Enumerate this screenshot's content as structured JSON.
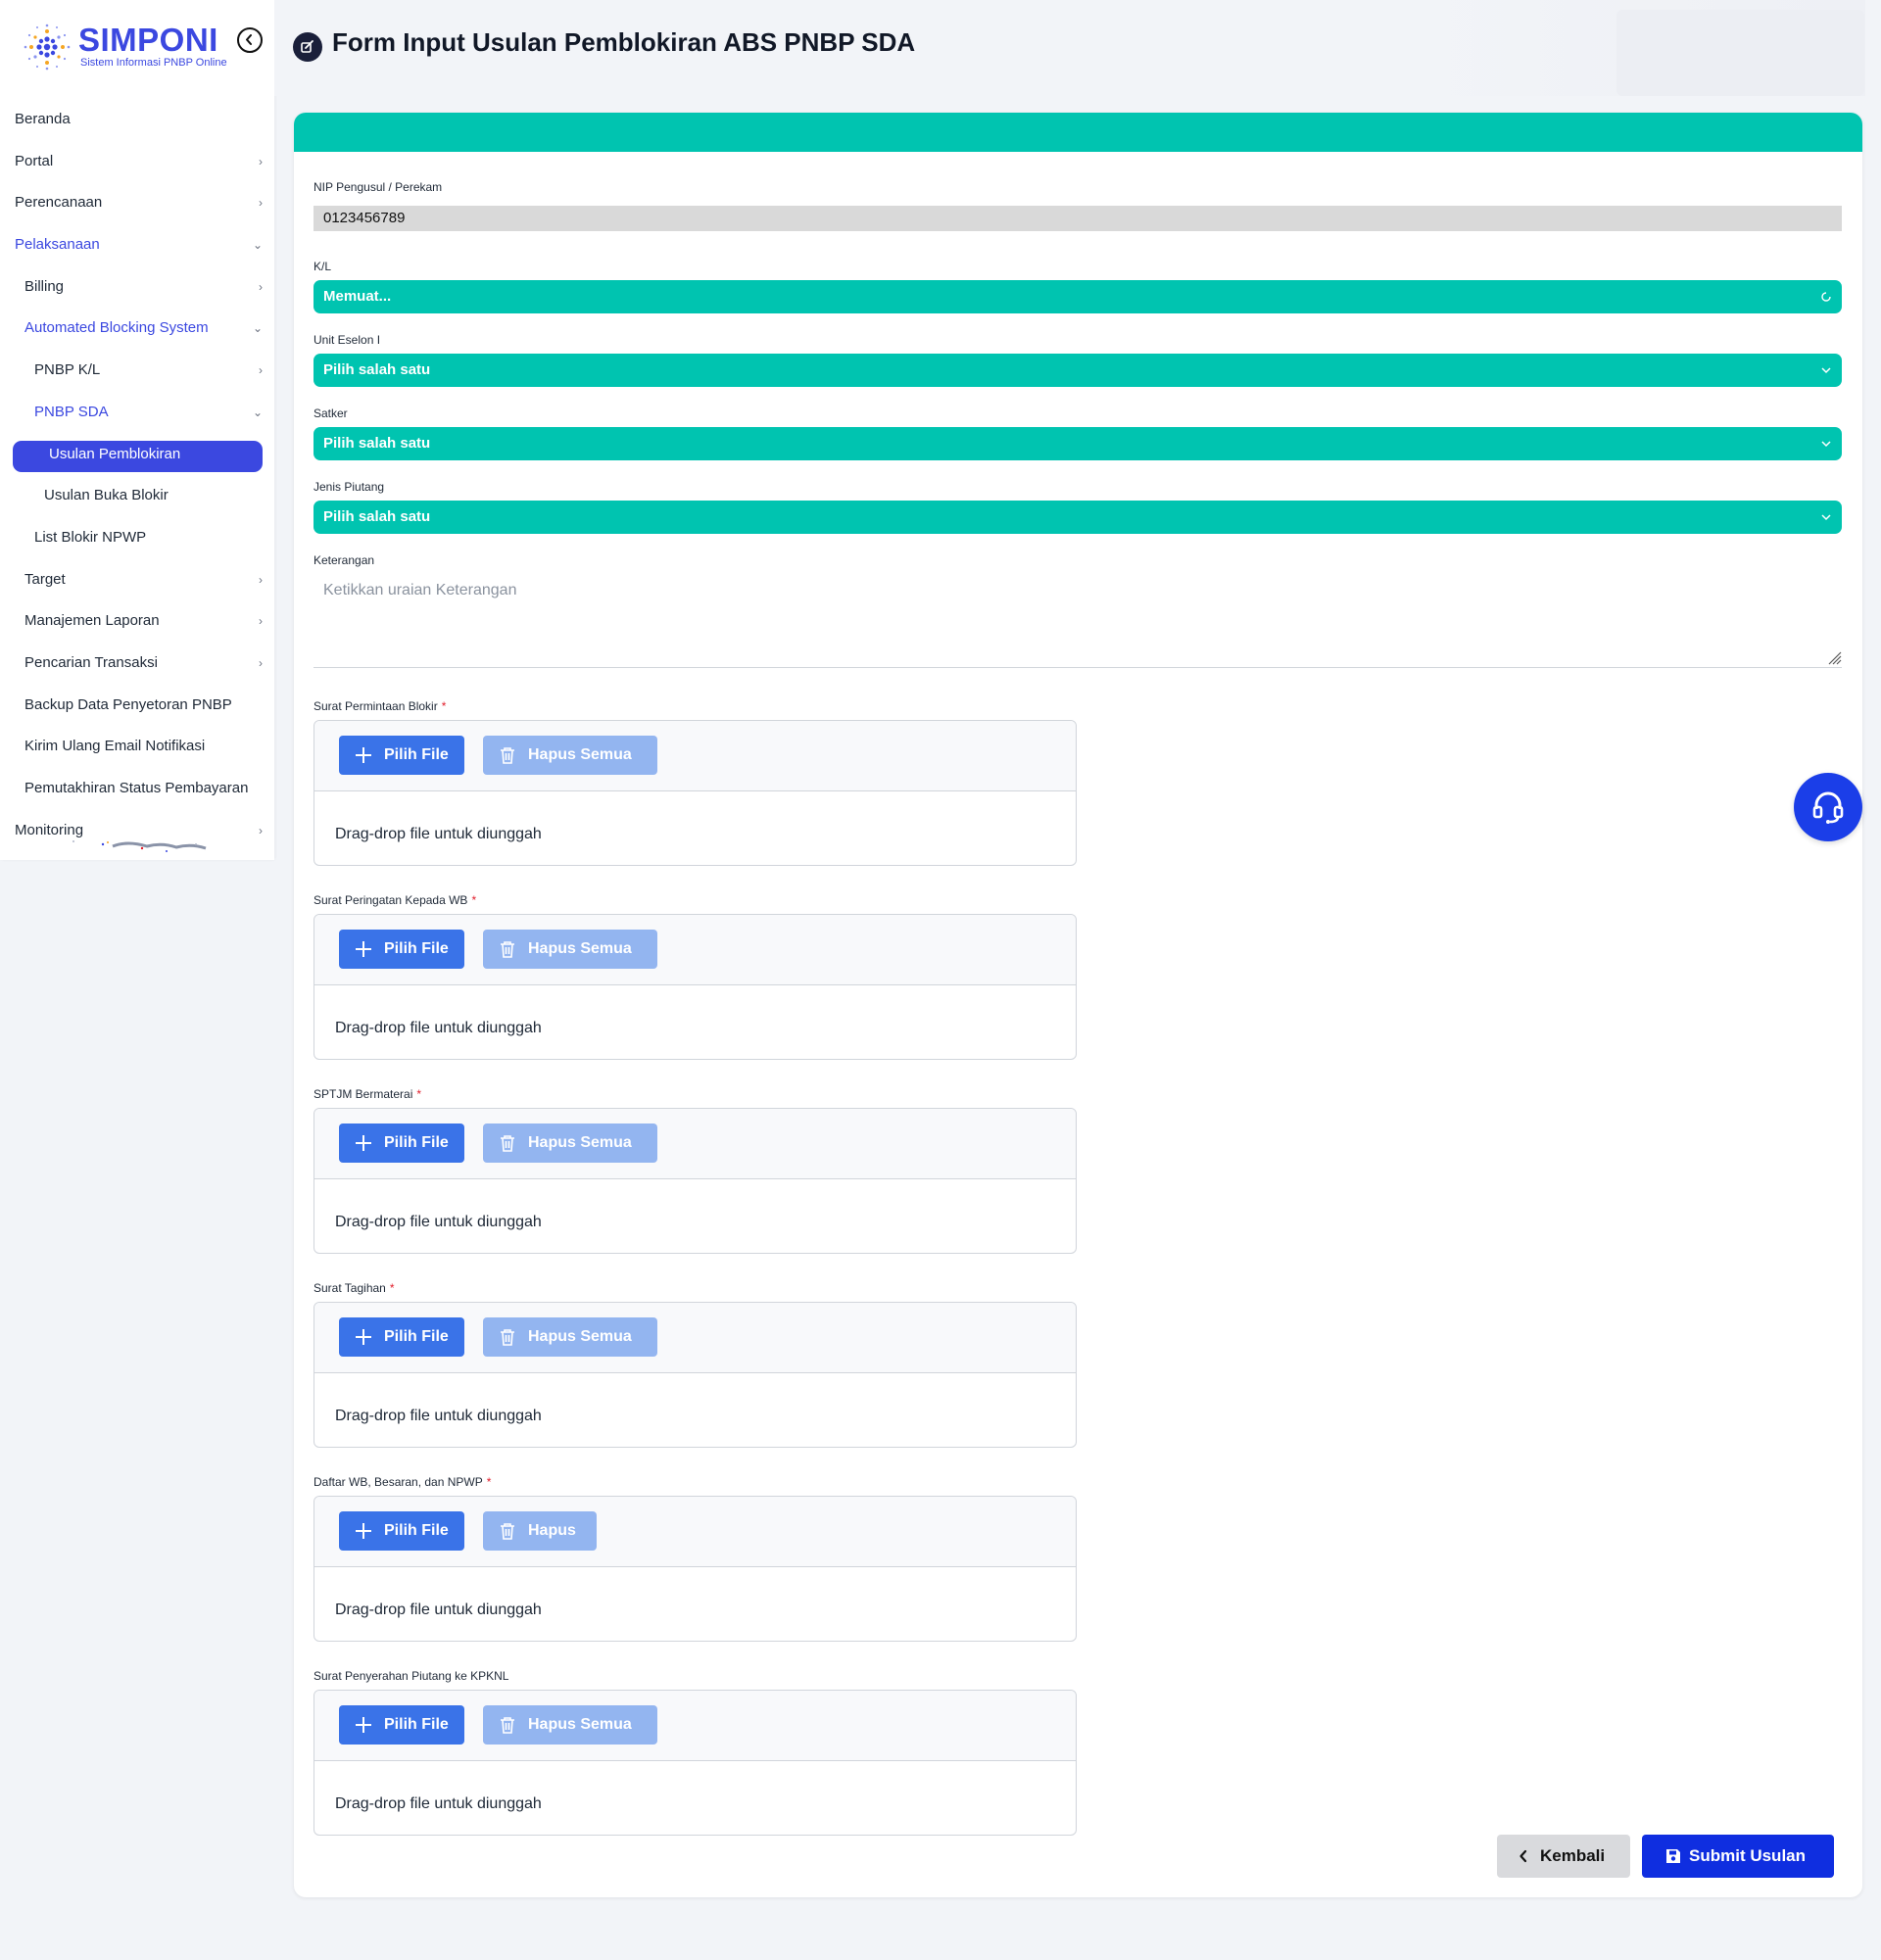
{
  "app": {
    "logo_title": "SIMPONI",
    "logo_subtitle": "Sistem Informasi PNBP Online"
  },
  "sidebar": {
    "items": [
      {
        "label": "Beranda",
        "level": 0,
        "chevron": ""
      },
      {
        "label": "Portal",
        "level": 0,
        "chevron": "›"
      },
      {
        "label": "Perencanaan",
        "level": 0,
        "chevron": "›"
      },
      {
        "label": "Pelaksanaan",
        "level": 0,
        "chevron": "⌄",
        "open": true
      },
      {
        "label": "Billing",
        "level": 1,
        "chevron": "›"
      },
      {
        "label": "Automated Blocking System",
        "level": 1,
        "chevron": "⌄",
        "open": true
      },
      {
        "label": "PNBP K/L",
        "level": 2,
        "chevron": "›"
      },
      {
        "label": "PNBP SDA",
        "level": 2,
        "chevron": "⌄",
        "open": true
      },
      {
        "label": "Usulan Pemblokiran",
        "level": 3,
        "chevron": "",
        "active": true
      },
      {
        "label": "Usulan Buka Blokir",
        "level": 3,
        "chevron": ""
      },
      {
        "label": "List Blokir NPWP",
        "level": 2,
        "chevron": ""
      },
      {
        "label": "Target",
        "level": 1,
        "chevron": "›"
      },
      {
        "label": "Manajemen Laporan",
        "level": 1,
        "chevron": "›"
      },
      {
        "label": "Pencarian Transaksi",
        "level": 1,
        "chevron": "›"
      },
      {
        "label": "Backup Data Penyetoran PNBP",
        "level": 1,
        "chevron": ""
      },
      {
        "label": "Kirim Ulang Email Notifikasi",
        "level": 1,
        "chevron": ""
      },
      {
        "label": "Pemutakhiran Status Pembayaran",
        "level": 1,
        "chevron": ""
      },
      {
        "label": "Monitoring",
        "level": 0,
        "chevron": "›"
      }
    ]
  },
  "header": {
    "title": "Form Input Usulan Pemblokiran ABS PNBP SDA"
  },
  "form": {
    "nip_label": "NIP Pengusul / Perekam",
    "nip_value": "0123456789",
    "kl_label": "K/L",
    "kl_value": "Memuat...",
    "eselon_label": "Unit Eselon I",
    "eselon_value": "Pilih salah satu",
    "satker_label": "Satker",
    "satker_value": "Pilih salah satu",
    "piutang_label": "Jenis Piutang",
    "piutang_value": "Pilih salah satu",
    "keterangan_label": "Keterangan",
    "keterangan_placeholder": "Ketikkan uraian Keterangan",
    "required_mark": "*",
    "uploads": [
      {
        "label": "Surat Permintaan Blokir",
        "required": true,
        "pick_label": "Pilih File",
        "delete_label": "Hapus Semua",
        "drop_text": "Drag-drop file untuk diunggah"
      },
      {
        "label": "Surat Peringatan Kepada WB",
        "required": true,
        "pick_label": "Pilih File",
        "delete_label": "Hapus Semua",
        "drop_text": "Drag-drop file untuk diunggah"
      },
      {
        "label": "SPTJM Bermaterai",
        "required": true,
        "pick_label": "Pilih File",
        "delete_label": "Hapus Semua",
        "drop_text": "Drag-drop file untuk diunggah"
      },
      {
        "label": "Surat Tagihan",
        "required": true,
        "pick_label": "Pilih File",
        "delete_label": "Hapus Semua",
        "drop_text": "Drag-drop file untuk diunggah"
      },
      {
        "label": "Daftar WB, Besaran, dan NPWP",
        "required": true,
        "pick_label": "Pilih File",
        "delete_label": "Hapus",
        "drop_text": "Drag-drop file untuk diunggah"
      },
      {
        "label": "Surat Penyerahan Piutang ke KPKNL",
        "required": false,
        "pick_label": "Pilih File",
        "delete_label": "Hapus Semua",
        "drop_text": "Drag-drop file untuk diunggah"
      }
    ],
    "back_label": "Kembali",
    "submit_label": "Submit Usulan"
  },
  "colors": {
    "brand": "#3b48e0",
    "teal": "#00c4b0",
    "primary_button": "#3a73e8",
    "submit": "#0f2ee0"
  },
  "icons": {
    "title": "edit-icon",
    "fab": "headset-icon",
    "loading": "spinner-icon"
  }
}
